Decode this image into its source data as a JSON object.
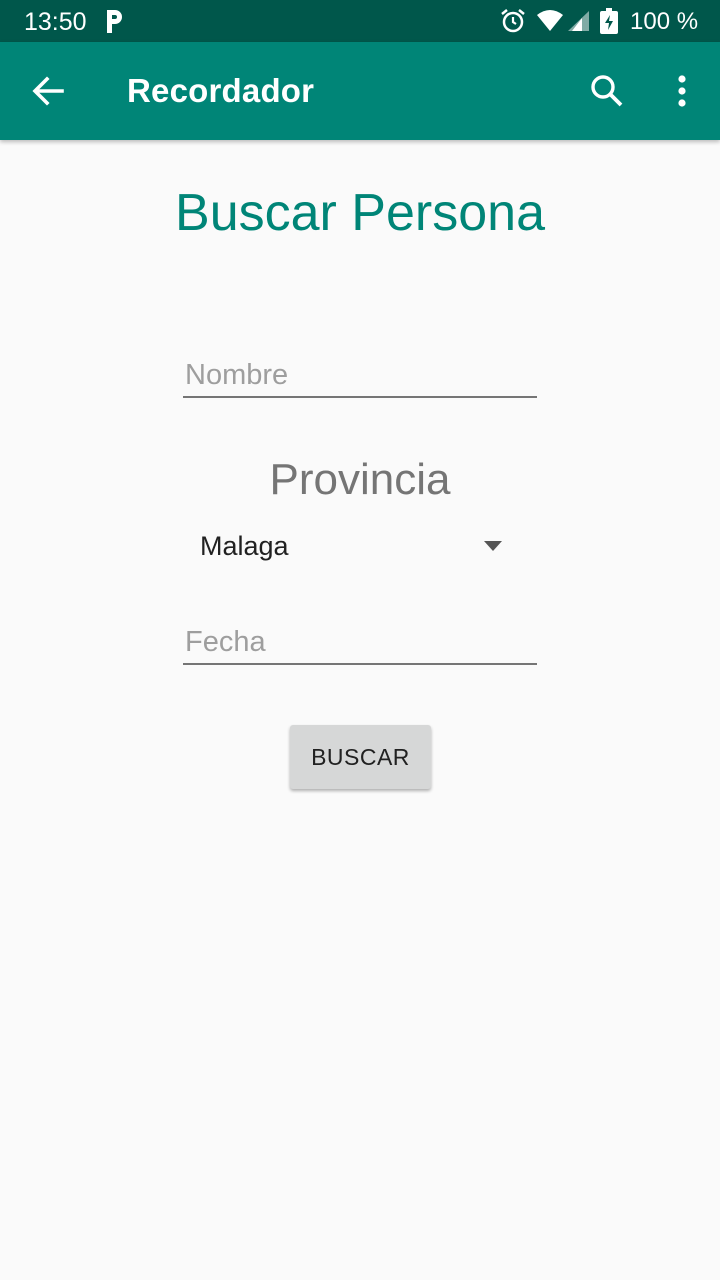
{
  "status_bar": {
    "time": "13:50",
    "battery": "100 %",
    "icons": [
      "parking-icon",
      "alarm-icon",
      "wifi-icon",
      "signal-icon",
      "battery-charging-icon"
    ]
  },
  "app_bar": {
    "title": "Recordador",
    "background": "#008577",
    "icons": [
      "back-arrow-icon",
      "search-icon",
      "more-vert-icon"
    ]
  },
  "form": {
    "heading": "Buscar Persona",
    "nombre_placeholder": "Nombre",
    "provincia_label": "Provincia",
    "provincia_selected": "Malaga",
    "fecha_placeholder": "Fecha",
    "submit_label": "BUSCAR"
  },
  "colors": {
    "accent": "#008577",
    "status_bar": "#00574b",
    "background": "#fafafa"
  }
}
